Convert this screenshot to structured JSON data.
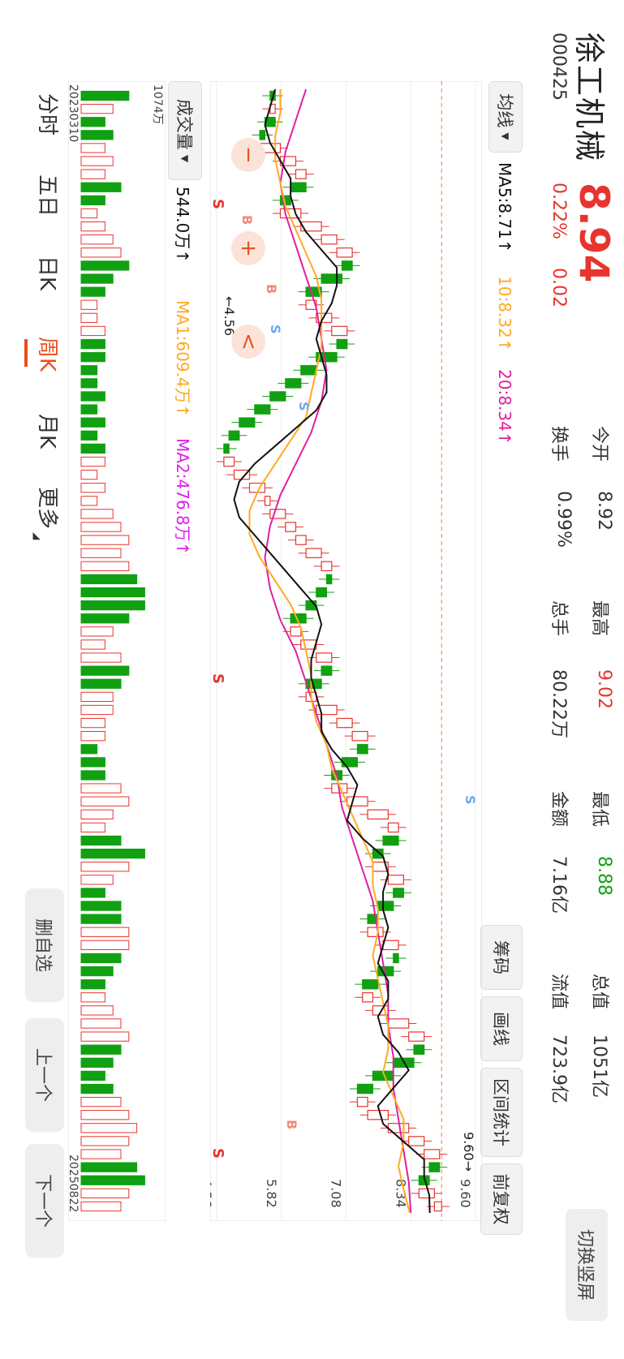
{
  "header": {
    "name": "徐工机械",
    "code": "000425",
    "price": "8.94",
    "change_pct": "0.22%",
    "change_amt": "0.02",
    "stats": [
      {
        "label": "今开",
        "value": "8.92"
      },
      {
        "label": "换手",
        "value": "0.99%"
      },
      {
        "label": "最高",
        "value": "9.02"
      },
      {
        "label": "总手",
        "value": "80.22万"
      },
      {
        "label": "最低",
        "value": "8.88"
      },
      {
        "label": "金额",
        "value": "7.16亿"
      },
      {
        "label": "总值",
        "value": "1051亿"
      },
      {
        "label": "流值",
        "value": "723.9亿"
      }
    ],
    "switch_label": "切换竖屏"
  },
  "toolbar": {
    "chips": "筹码",
    "draw": "画线",
    "range": "区间统计",
    "adjust": "前复权"
  },
  "ma": {
    "selector": "均线",
    "ma5": "MA5:8.71↑",
    "ma10": "10:8.32↑",
    "ma20": "20:8.34↑"
  },
  "volume": {
    "selector": "成交量",
    "value": "544.0万↑",
    "ma1": "MA1:609.4万↑",
    "ma2": "MA2:476.8万↑",
    "max": "1074万"
  },
  "axis": {
    "y_ticks": [
      "9.60",
      "8.34",
      "7.08",
      "5.82",
      "4.56"
    ],
    "start_date": "20230310",
    "end_date": "20250822",
    "max_marker": "9.60",
    "min_marker": "4.56"
  },
  "signals": {
    "b": "B",
    "s": "S"
  },
  "zoom": {
    "minus": "−",
    "plus": "+",
    "left": "<"
  },
  "tabs": [
    "分时",
    "五日",
    "日K",
    "周K",
    "月K",
    "更多"
  ],
  "active_tab": "周K",
  "side_buttons": [
    "删自选",
    "上一个",
    "下一个"
  ],
  "colors": {
    "up": "#e8342e",
    "down": "#11a011",
    "ma5": "#111111",
    "ma10": "#ffaa22",
    "ma20": "#e020a0"
  },
  "chart_data": {
    "type": "candlestick",
    "x_range": [
      "20230310",
      "20250822"
    ],
    "y_range": [
      4.56,
      9.6
    ],
    "close_approx": [
      5.6,
      5.7,
      5.5,
      5.4,
      5.8,
      6.1,
      6.3,
      6.0,
      5.8,
      6.2,
      6.6,
      6.9,
      7.2,
      7.0,
      6.6,
      6.3,
      6.5,
      6.8,
      7.1,
      6.9,
      6.5,
      6.2,
      5.9,
      5.6,
      5.3,
      5.0,
      4.8,
      4.7,
      4.9,
      5.2,
      5.5,
      5.6,
      5.9,
      6.1,
      6.3,
      6.6,
      6.8,
      6.7,
      6.5,
      6.3,
      6.0,
      6.2,
      6.5,
      6.8,
      6.6,
      6.3,
      6.5,
      6.9,
      7.2,
      7.5,
      7.3,
      7.0,
      6.8,
      7.1,
      7.5,
      7.9,
      8.1,
      7.8,
      7.6,
      7.9,
      8.2,
      8.0,
      7.7,
      7.5,
      7.8,
      8.1,
      8.0,
      7.7,
      7.4,
      7.6,
      7.9,
      8.3,
      8.6,
      8.4,
      8.0,
      7.6,
      7.3,
      7.5,
      7.9,
      8.3,
      8.6,
      8.9,
      8.7,
      8.5,
      8.8,
      8.94
    ],
    "volume_approx": [
      6,
      4,
      3,
      4,
      3,
      4,
      3,
      5,
      3,
      2,
      3,
      4,
      5,
      6,
      4,
      3,
      2,
      2,
      3,
      3,
      3,
      2,
      2,
      3,
      2,
      3,
      2,
      3,
      3,
      2,
      3,
      2,
      4,
      5,
      6,
      5,
      6,
      7,
      8,
      8,
      6,
      4,
      3,
      5,
      6,
      5,
      4,
      4,
      3,
      3,
      2,
      3,
      3,
      5,
      6,
      4,
      3,
      5,
      8,
      6,
      4,
      3,
      5,
      5,
      6,
      6,
      5,
      4,
      3,
      3,
      4,
      5,
      6,
      5,
      4,
      3,
      4,
      5,
      6,
      7,
      6,
      5,
      7,
      8,
      6,
      5
    ],
    "ma5_approx": [
      5.7,
      5.6,
      5.5,
      5.6,
      5.8,
      6.0,
      6.0,
      6.1,
      6.3,
      6.6,
      6.9,
      6.9,
      6.8,
      6.6,
      6.5,
      6.6,
      6.7,
      6.7,
      6.5,
      6.1,
      5.7,
      5.3,
      5.0,
      4.9,
      5.0,
      5.3,
      5.6,
      5.9,
      6.2,
      6.5,
      6.6,
      6.5,
      6.4,
      6.4,
      6.5,
      6.6,
      6.6,
      6.8,
      7.1,
      7.3,
      7.2,
      7.1,
      7.4,
      7.8,
      7.9,
      7.8,
      7.8,
      7.9,
      7.8,
      7.7,
      7.9,
      7.9,
      7.7,
      7.8,
      8.1,
      8.3,
      8.0,
      7.7,
      7.8,
      8.2,
      8.6,
      8.6,
      8.7,
      8.71
    ],
    "ma10_approx": [
      5.8,
      5.8,
      5.7,
      5.7,
      5.8,
      5.9,
      6.1,
      6.3,
      6.5,
      6.6,
      6.6,
      6.6,
      6.5,
      6.4,
      6.3,
      6.0,
      5.7,
      5.4,
      5.2,
      5.2,
      5.4,
      5.7,
      6.0,
      6.2,
      6.3,
      6.4,
      6.4,
      6.5,
      6.7,
      6.8,
      7.0,
      7.2,
      7.4,
      7.6,
      7.6,
      7.7,
      7.7,
      7.6,
      7.7,
      7.8,
      7.9,
      7.9,
      7.8,
      8.0,
      8.2,
      8.2,
      8.1,
      8.2,
      8.32
    ],
    "ma20_approx": [
      6.3,
      6.1,
      5.9,
      5.8,
      5.9,
      6.1,
      6.3,
      6.5,
      6.6,
      6.7,
      6.6,
      6.4,
      6.1,
      5.8,
      5.6,
      5.5,
      5.6,
      5.8,
      6.1,
      6.3,
      6.5,
      6.7,
      6.9,
      7.0,
      7.2,
      7.4,
      7.6,
      7.7,
      7.8,
      7.9,
      7.9,
      8.0,
      8.0,
      8.1,
      8.2,
      8.3,
      8.34
    ],
    "title": "",
    "xlabel": "",
    "ylabel": ""
  }
}
